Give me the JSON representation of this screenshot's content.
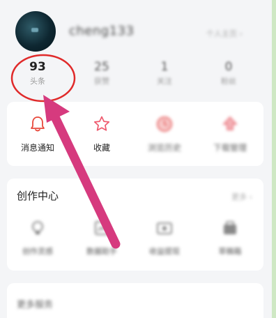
{
  "profile": {
    "username": "cheng133",
    "profile_link": "个人主页 ›"
  },
  "stats": [
    {
      "value": "93",
      "label": "头条"
    },
    {
      "value": "25",
      "label": "获赞"
    },
    {
      "value": "1",
      "label": "关注"
    },
    {
      "value": "0",
      "label": "粉丝"
    }
  ],
  "quick_actions": [
    {
      "label": "消息通知",
      "icon": "bell-icon"
    },
    {
      "label": "收藏",
      "icon": "star-icon"
    },
    {
      "label": "浏览历史",
      "icon": "clock-icon"
    },
    {
      "label": "下载管理",
      "icon": "download-icon"
    }
  ],
  "creation": {
    "title": "创作中心",
    "more": "更多 ›",
    "items": [
      {
        "label": "创作灵感",
        "icon": "lightbulb-icon"
      },
      {
        "label": "数据助手",
        "icon": "chart-icon"
      },
      {
        "label": "收益提现",
        "icon": "wallet-icon"
      },
      {
        "label": "草稿箱",
        "icon": "drafts-icon"
      }
    ]
  },
  "services": {
    "title": "更多服务"
  },
  "colors": {
    "annotation": "#e02a2a",
    "arrow": "#d63a7e",
    "bell": "#e8483b",
    "star": "#ef5a6e"
  }
}
